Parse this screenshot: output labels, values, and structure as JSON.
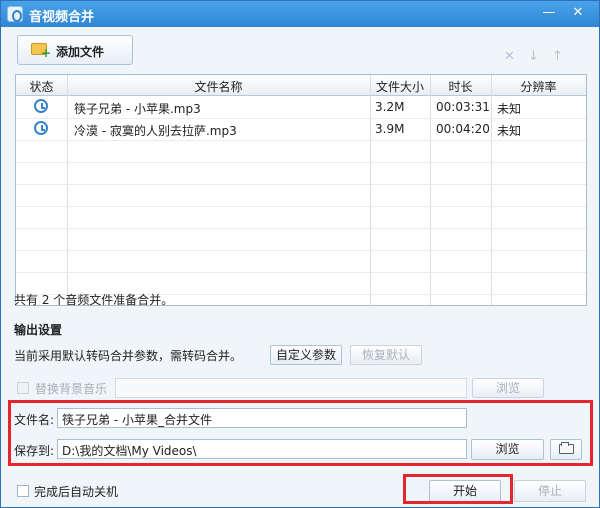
{
  "window": {
    "title": "音视频合并",
    "minimize_glyph": "—",
    "close_glyph": "✕"
  },
  "toolbar": {
    "add_file_label": "添加文件",
    "delete_icon": "✕",
    "down_icon": "↓",
    "up_icon": "↑"
  },
  "table": {
    "columns": [
      "状态",
      "文件名称",
      "文件大小",
      "时长",
      "分辨率"
    ],
    "rows": [
      {
        "status_icon": "clock-icon",
        "name": "筷子兄弟 - 小苹果.mp3",
        "size": "3.2M",
        "duration": "00:03:31",
        "resolution": "未知"
      },
      {
        "status_icon": "clock-icon",
        "name": "冷漠 - 寂寞的人别去拉萨.mp3",
        "size": "3.9M",
        "duration": "00:04:20",
        "resolution": "未知"
      }
    ]
  },
  "summary_text": "共有 2 个音频文件准备合并。",
  "output": {
    "section_title": "输出设置",
    "description": "当前采用默认转码合并参数，需转码合并。",
    "custom_params_button": "自定义参数",
    "restore_default_button": "恢复默认",
    "bg_music_label": "替换背景音乐",
    "bg_music_browse_button": "浏览",
    "filename_label": "文件名:",
    "filename_value": "筷子兄弟 - 小苹果_合并文件",
    "save_to_label": "保存到:",
    "save_to_value": "D:\\我的文档\\My Videos\\",
    "save_browse_button": "浏览"
  },
  "footer": {
    "auto_shutdown_label": "完成后自动关机",
    "start_button": "开始",
    "stop_button": "停止"
  },
  "colors": {
    "title_bar": "#3a8fd6",
    "highlight": "#e6262f",
    "disabled_text": "#a7b0ba"
  }
}
